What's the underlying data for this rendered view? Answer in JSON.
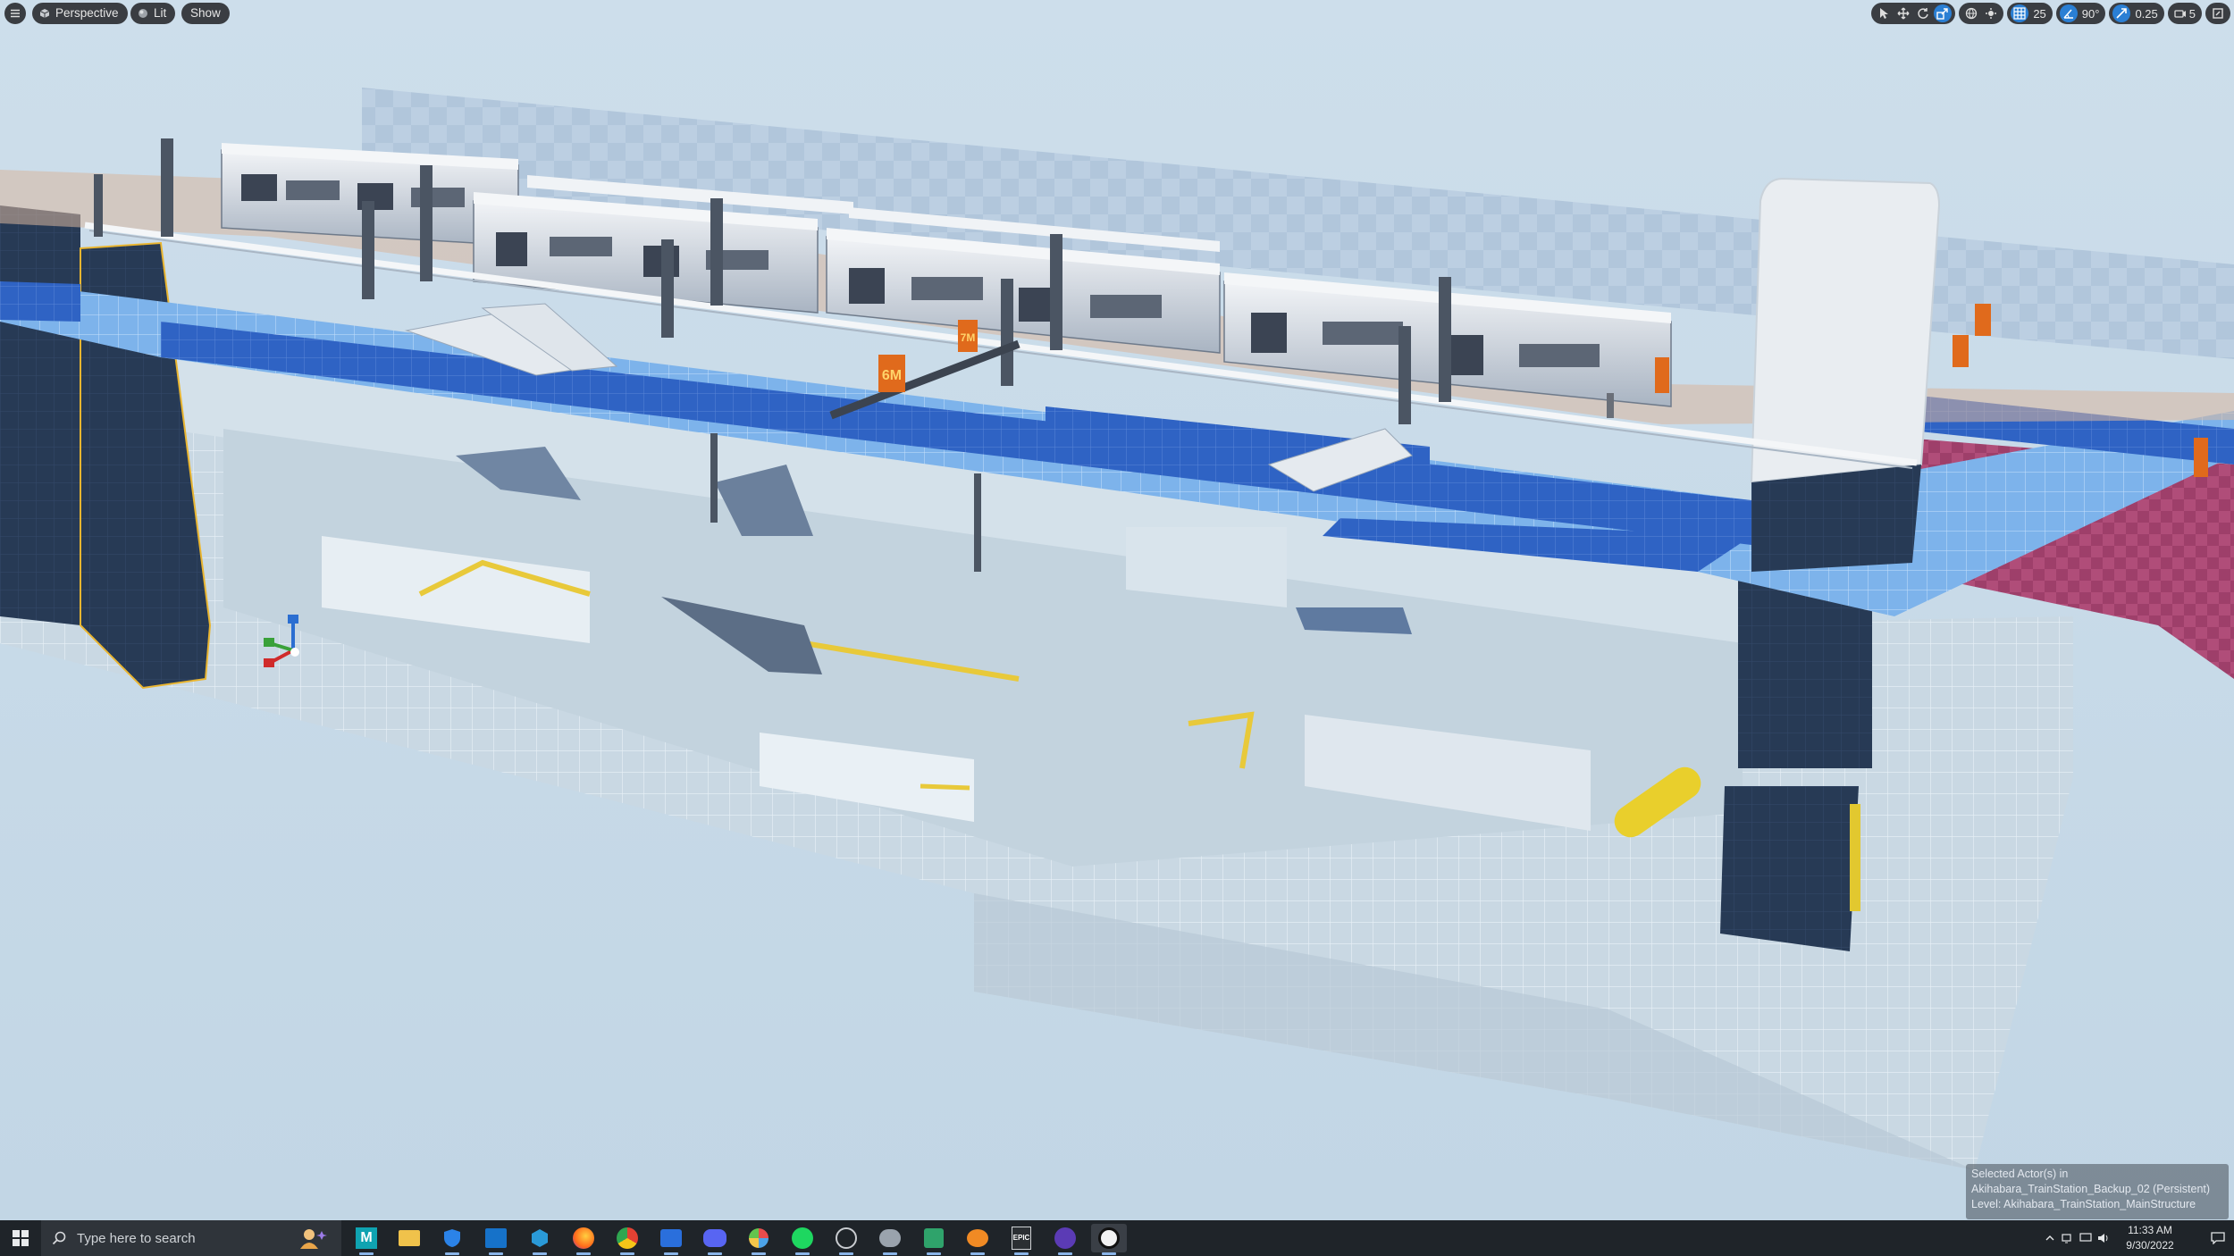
{
  "viewport": {
    "view_mode": "Perspective",
    "lighting_mode": "Lit",
    "show_label": "Show",
    "grid_snap_value": "25",
    "rotation_snap_value": "90°",
    "scale_snap_value": "0.25",
    "camera_speed_value": "5",
    "signs": [
      "6M",
      "7M"
    ]
  },
  "selection_info": {
    "line1": "Selected Actor(s) in",
    "line2": "Akihabara_TrainStation_Backup_02 (Persistent)",
    "line3": "Level:  Akihabara_TrainStation_MainStructure"
  },
  "taskbar": {
    "search_placeholder": "Type here to search",
    "time": "11:33 AM",
    "date": "9/30/2022",
    "apps": [
      "maya-icon",
      "file-explorer-icon",
      "security-shield-icon",
      "outlook-icon",
      "3d-cube-app-icon",
      "firefox-icon",
      "chrome-icon",
      "photos-icon",
      "discord-icon",
      "davinci-icon",
      "spotify-icon",
      "obs-icon",
      "vpn-icon",
      "gaming-app-icon",
      "blender-icon",
      "epic-games-icon",
      "unreal-editor-icon",
      "unreal-engine-icon"
    ]
  },
  "colors": {
    "accent": "#2a7fd4",
    "platform_blue": "#2f63c4",
    "platform_light_blue": "#7db3eb",
    "structure_gray": "#c6d5e0",
    "pink_wall": "#b04d79"
  }
}
